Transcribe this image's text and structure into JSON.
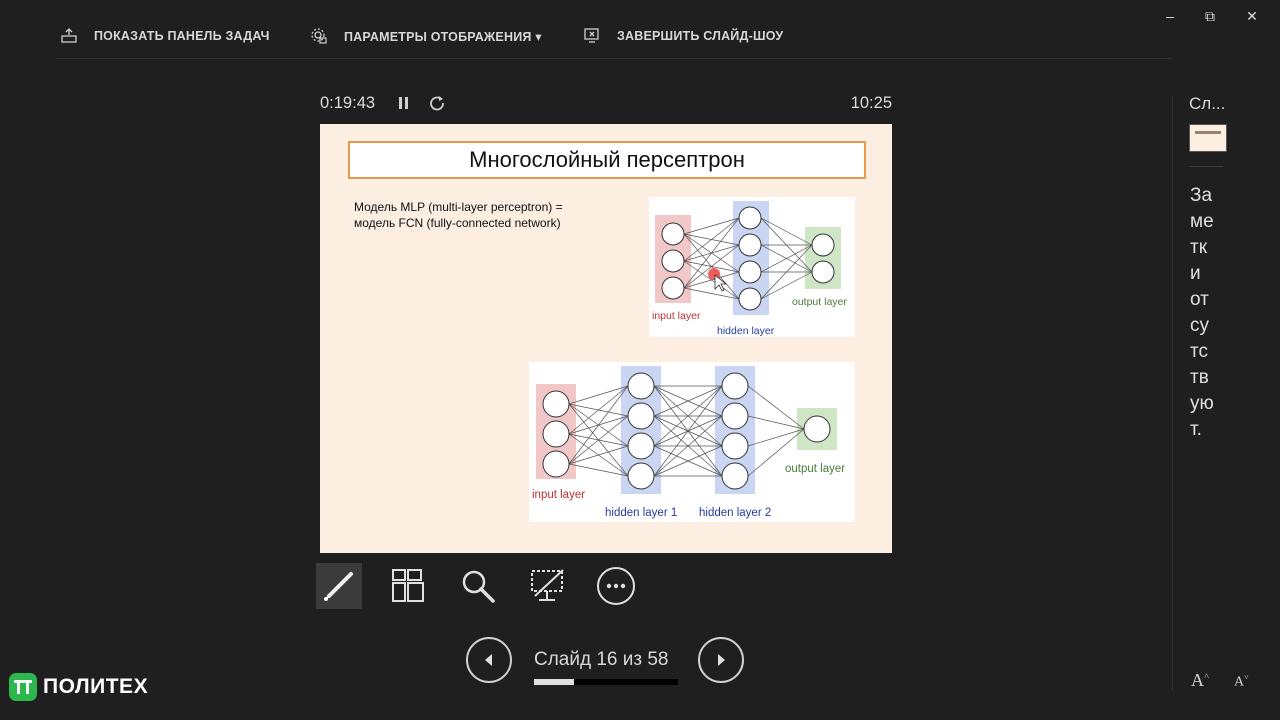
{
  "topbar": {
    "taskbar_label": "ПОКАЗАТЬ ПАНЕЛЬ ЗАДАЧ",
    "display_label": "ПАРАМЕТРЫ ОТОБРАЖЕНИЯ ▾",
    "end_label": "ЗАВЕРШИТЬ СЛАЙД-ШОУ"
  },
  "window": {
    "minimize": "–",
    "restore": "⧉",
    "close": "✕"
  },
  "timer": {
    "elapsed": "0:19:43",
    "clock": "10:25"
  },
  "slide": {
    "title": "Многослойный персептрон",
    "body_line1": "Модель MLP (multi-layer perceptron) =",
    "body_line2": "модель FCN (fully-connected network)",
    "diagram1": {
      "input": "input layer",
      "hidden": "hidden layer",
      "output": "output layer"
    },
    "diagram2": {
      "input": "input layer",
      "hidden1": "hidden layer 1",
      "hidden2": "hidden layer 2",
      "output": "output layer"
    }
  },
  "tools": [
    "pen-tool",
    "see-all-slides",
    "zoom",
    "black-screen",
    "more-options"
  ],
  "nav": {
    "counter": "Слайд 16 из 58",
    "progress_fraction": 0.276
  },
  "side": {
    "slides_label": "Сл...",
    "notes": "Заметки отсутствуют.",
    "font_increase": "A",
    "font_decrease": "A"
  },
  "logo": {
    "text": "ПОЛИТЕХ"
  },
  "colors": {
    "background": "#1f1f1f",
    "slide_bg": "#fcefe2",
    "title_border": "#e59a4c",
    "logo_green": "#2db84f"
  }
}
